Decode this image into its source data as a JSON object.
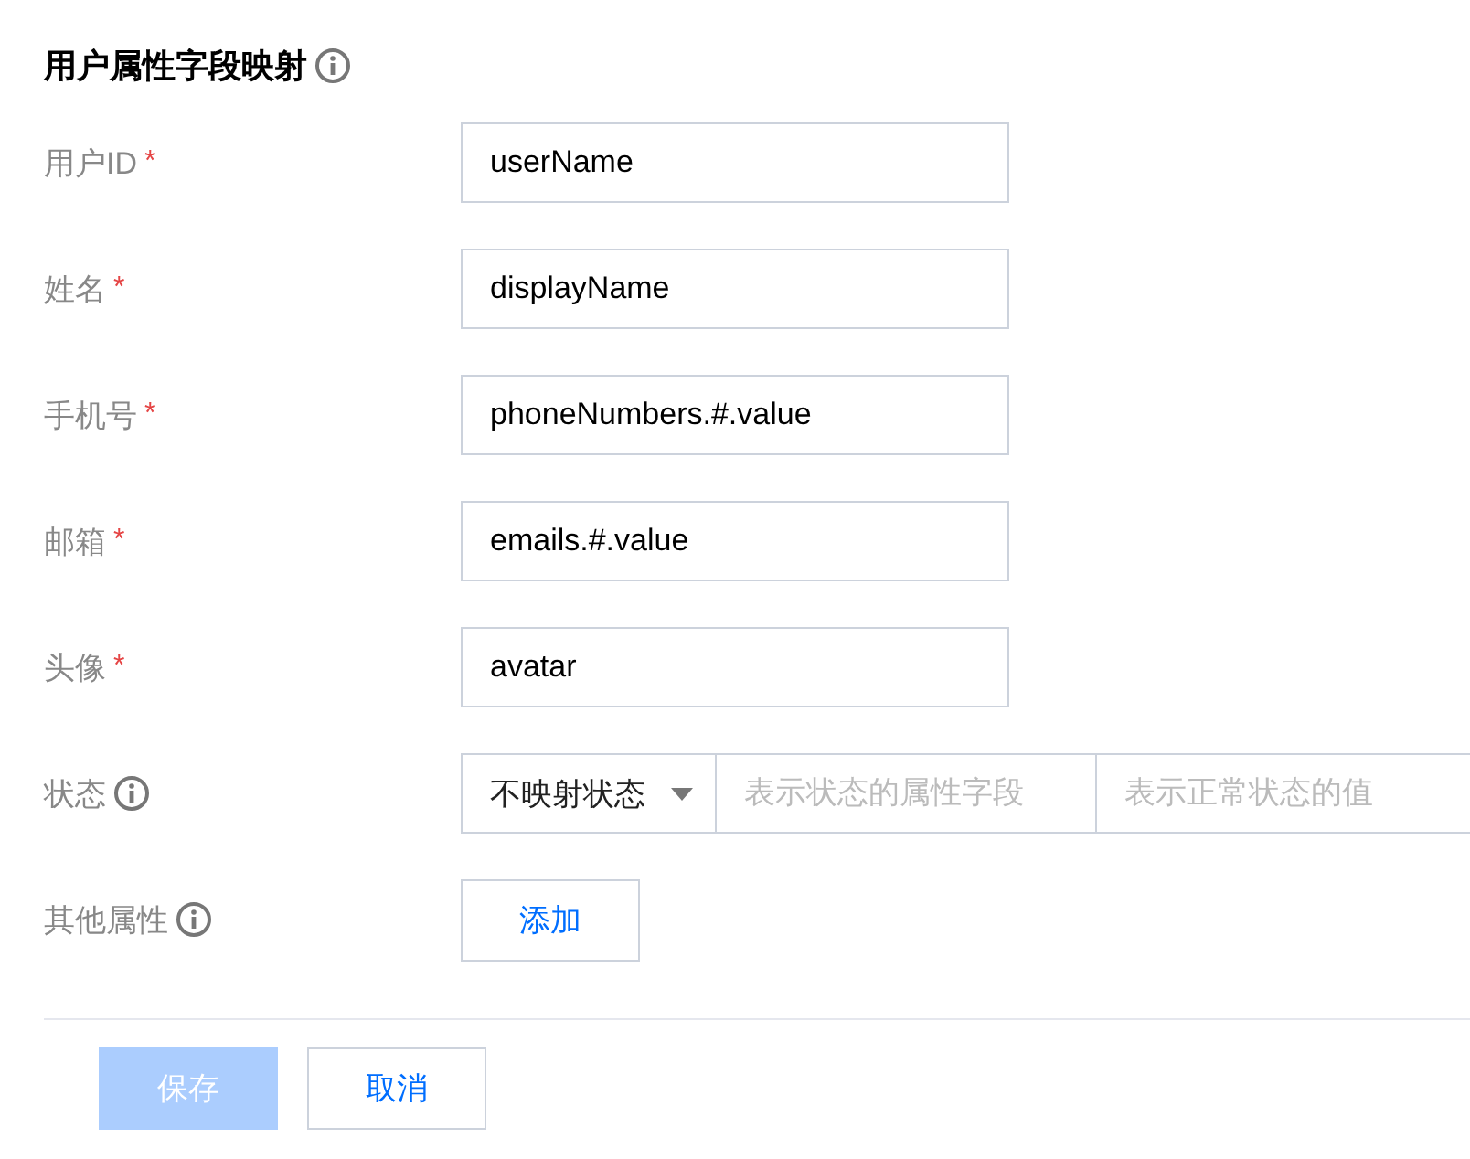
{
  "section": {
    "title": "用户属性字段映射",
    "has_info": true
  },
  "fields": [
    {
      "kind": "text",
      "label": "用户ID",
      "required_mark": "*",
      "has_info": false,
      "value": "userName"
    },
    {
      "kind": "text",
      "label": "姓名",
      "required_mark": "*",
      "has_info": false,
      "value": "displayName"
    },
    {
      "kind": "text",
      "label": "手机号",
      "required_mark": "*",
      "has_info": false,
      "value": "phoneNumbers.#.value"
    },
    {
      "kind": "text",
      "label": "邮箱",
      "required_mark": "*",
      "has_info": false,
      "value": "emails.#.value"
    },
    {
      "kind": "text",
      "label": "头像",
      "required_mark": "*",
      "has_info": false,
      "value": "avatar"
    },
    {
      "kind": "status",
      "label": "状态",
      "has_info": true,
      "select": "不映射状态",
      "placeholders": [
        "表示状态的属性字段",
        "表示正常状态的值"
      ]
    },
    {
      "kind": "button",
      "label": "其他属性",
      "has_info": true,
      "button": "添加"
    }
  ],
  "actions": [
    {
      "label": "保存",
      "primary": true,
      "disabled": true
    },
    {
      "label": "取消",
      "primary": false,
      "disabled": false
    }
  ]
}
